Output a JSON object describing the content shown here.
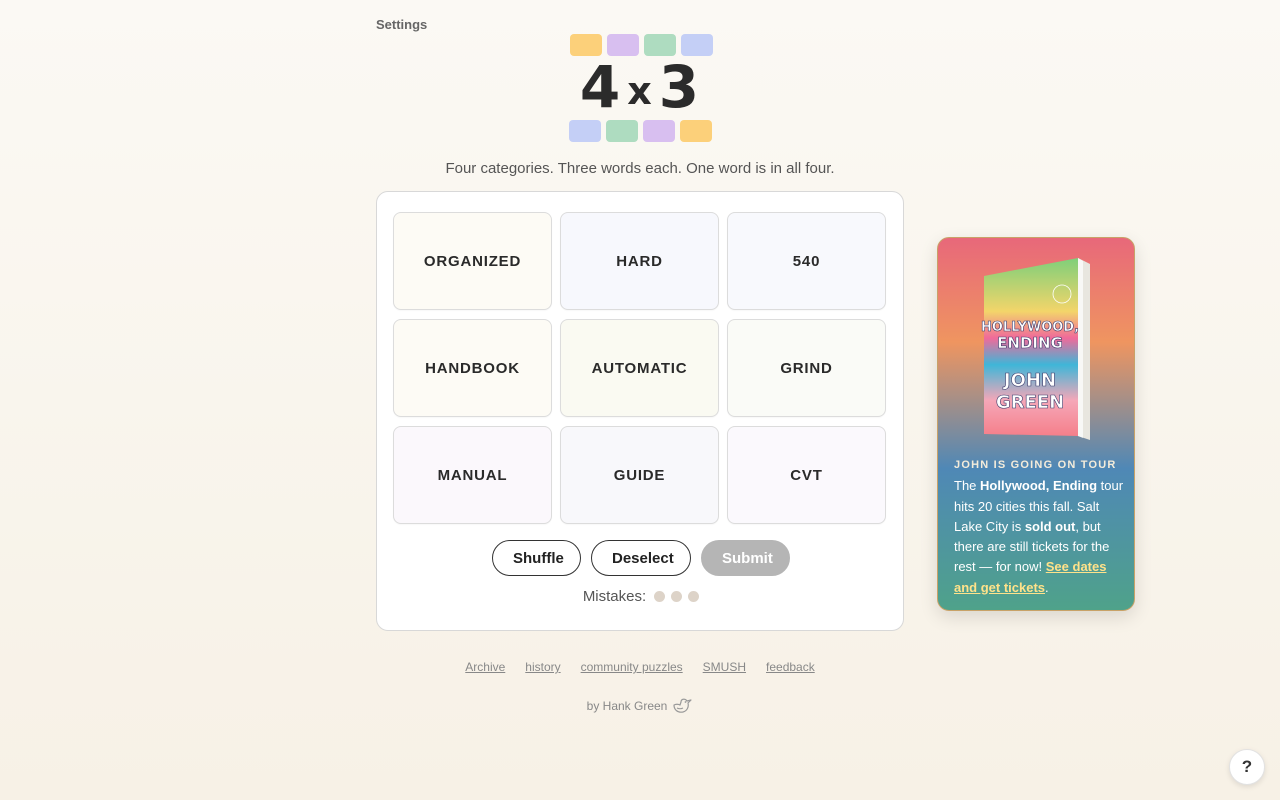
{
  "header": {
    "settings_label": "Settings"
  },
  "logo": {
    "left_digit": "4",
    "times": "x",
    "right_digit": "3",
    "top_colors": [
      "#fcd07a",
      "#d8bff0",
      "#aedcc0",
      "#c4cff6"
    ],
    "bottom_colors": [
      "#c4cff6",
      "#aedcc0",
      "#d8bff0",
      "#fcd07a"
    ]
  },
  "tagline": "Four categories. Three words each. One word is in all four.",
  "board": {
    "tiles": [
      {
        "word": "ORGANIZED",
        "bg": "#fdfbf5"
      },
      {
        "word": "HARD",
        "bg": "#f7f8fd"
      },
      {
        "word": "540",
        "bg": "#f8f9fd"
      },
      {
        "word": "HANDBOOK",
        "bg": "#fdfbf5"
      },
      {
        "word": "AUTOMATIC",
        "bg": "#fafaf2"
      },
      {
        "word": "GRIND",
        "bg": "#fafbf7"
      },
      {
        "word": "MANUAL",
        "bg": "#fbf8fc"
      },
      {
        "word": "GUIDE",
        "bg": "#f8f8fb"
      },
      {
        "word": "CVT",
        "bg": "#fbf9fd"
      }
    ],
    "shuffle_label": "Shuffle",
    "deselect_label": "Deselect",
    "submit_label": "Submit",
    "mistakes_label": "Mistakes:",
    "mistakes_remaining": 3
  },
  "footer": {
    "links": [
      "Archive",
      "history",
      "community puzzles",
      "SMUSH",
      "feedback"
    ],
    "byline": "by Hank Green"
  },
  "promo": {
    "book_title_line1": "HOLLYWOOD,",
    "book_title_line2": "ENDING",
    "book_author_line1": "JOHN",
    "book_author_line2": "GREEN",
    "kicker": "JOHN IS GOING ON TOUR",
    "text_the": "The",
    "book_name": "Hollywood, Ending",
    "text_1": "tour hits 20 cities this fall. Salt Lake City is",
    "sold_out": "sold out",
    "text_2": ", but there are still tickets for the rest — for now!",
    "link": "See dates and get tickets",
    "period": "."
  },
  "help_label": "?"
}
